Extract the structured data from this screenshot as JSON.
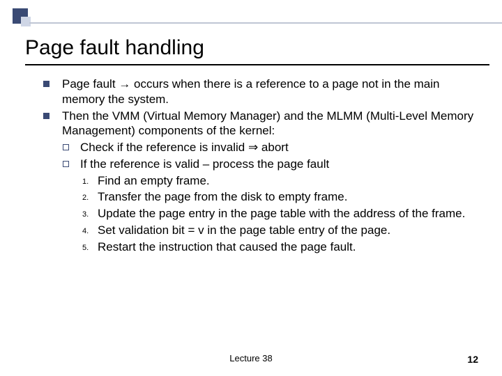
{
  "title": "Page fault handling",
  "bullets": [
    "Page fault → occurs when there is a reference to a page not in the main memory the system.",
    "Then the VMM (Virtual Memory Manager) and the MLMM (Multi-Level Memory Management) components of the  kernel:"
  ],
  "sub": [
    "Check if the reference is invalid ⇒ abort",
    "If the reference is valid – process the page fault"
  ],
  "steps": [
    "Find an empty frame.",
    "Transfer the page from the disk  to empty frame.",
    "Update the page entry in the page table with the address of the frame.",
    "Set validation bit = v in the page table entry of the page.",
    "Restart the instruction that caused the page fault."
  ],
  "numLabels": [
    "1.",
    "2.",
    "3.",
    "4.",
    "5."
  ],
  "footer": "Lecture 38",
  "slideNum": "12"
}
